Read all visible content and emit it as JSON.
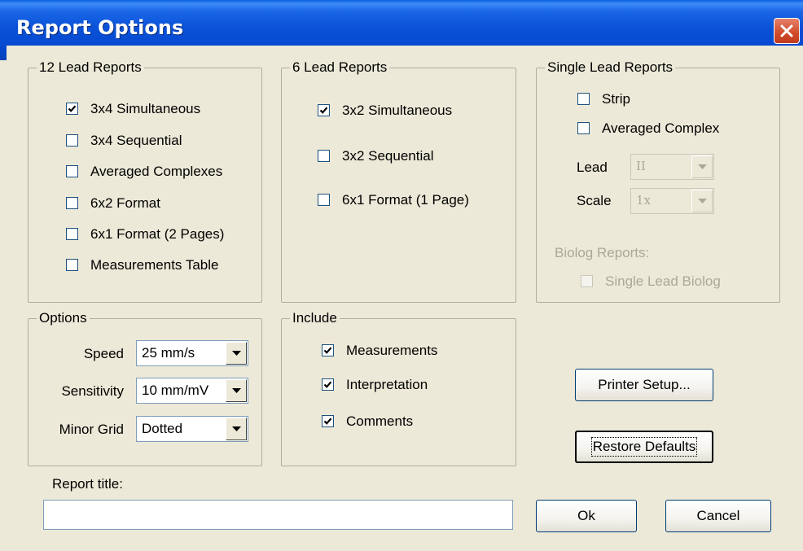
{
  "window": {
    "title": "Report Options"
  },
  "groups": {
    "twelve_lead": {
      "label": "12 Lead Reports",
      "items": [
        {
          "label": "3x4 Simultaneous",
          "checked": true
        },
        {
          "label": "3x4 Sequential",
          "checked": false
        },
        {
          "label": "Averaged Complexes",
          "checked": false
        },
        {
          "label": "6x2 Format",
          "checked": false
        },
        {
          "label": "6x1 Format (2 Pages)",
          "checked": false
        },
        {
          "label": "Measurements Table",
          "checked": false
        }
      ]
    },
    "six_lead": {
      "label": "6 Lead Reports",
      "items": [
        {
          "label": "3x2 Simultaneous",
          "checked": true
        },
        {
          "label": "3x2 Sequential",
          "checked": false
        },
        {
          "label": "6x1 Format (1 Page)",
          "checked": false
        }
      ]
    },
    "single_lead": {
      "label": "Single Lead Reports",
      "items": [
        {
          "label": "Strip",
          "checked": false
        },
        {
          "label": "Averaged Complex",
          "checked": false
        }
      ],
      "lead_label": "Lead",
      "lead_value": "II",
      "scale_label": "Scale",
      "scale_value": "1x",
      "biolog_label": "Biolog Reports:",
      "biolog_item": {
        "label": "Single Lead Biolog",
        "checked": false,
        "enabled": false
      }
    },
    "options": {
      "label": "Options",
      "speed_label": "Speed",
      "speed_value": "25 mm/s",
      "sensitivity_label": "Sensitivity",
      "sensitivity_value": "10 mm/mV",
      "minor_grid_label": "Minor Grid",
      "minor_grid_value": "Dotted"
    },
    "include": {
      "label": "Include",
      "items": [
        {
          "label": "Measurements",
          "checked": true
        },
        {
          "label": "Interpretation",
          "checked": true
        },
        {
          "label": "Comments",
          "checked": true
        }
      ]
    }
  },
  "buttons": {
    "printer_setup": "Printer Setup...",
    "restore_defaults": "Restore Defaults",
    "ok": "Ok",
    "cancel": "Cancel"
  },
  "report_title": {
    "label": "Report title:",
    "value": ""
  },
  "icons": {
    "close": "close-icon",
    "check": "checkmark-icon",
    "dropdown": "chevron-down-icon"
  },
  "colors": {
    "title_bar": "#0a52d8",
    "dialog_bg": "#ece9d8",
    "close_button": "#d14a2a"
  }
}
